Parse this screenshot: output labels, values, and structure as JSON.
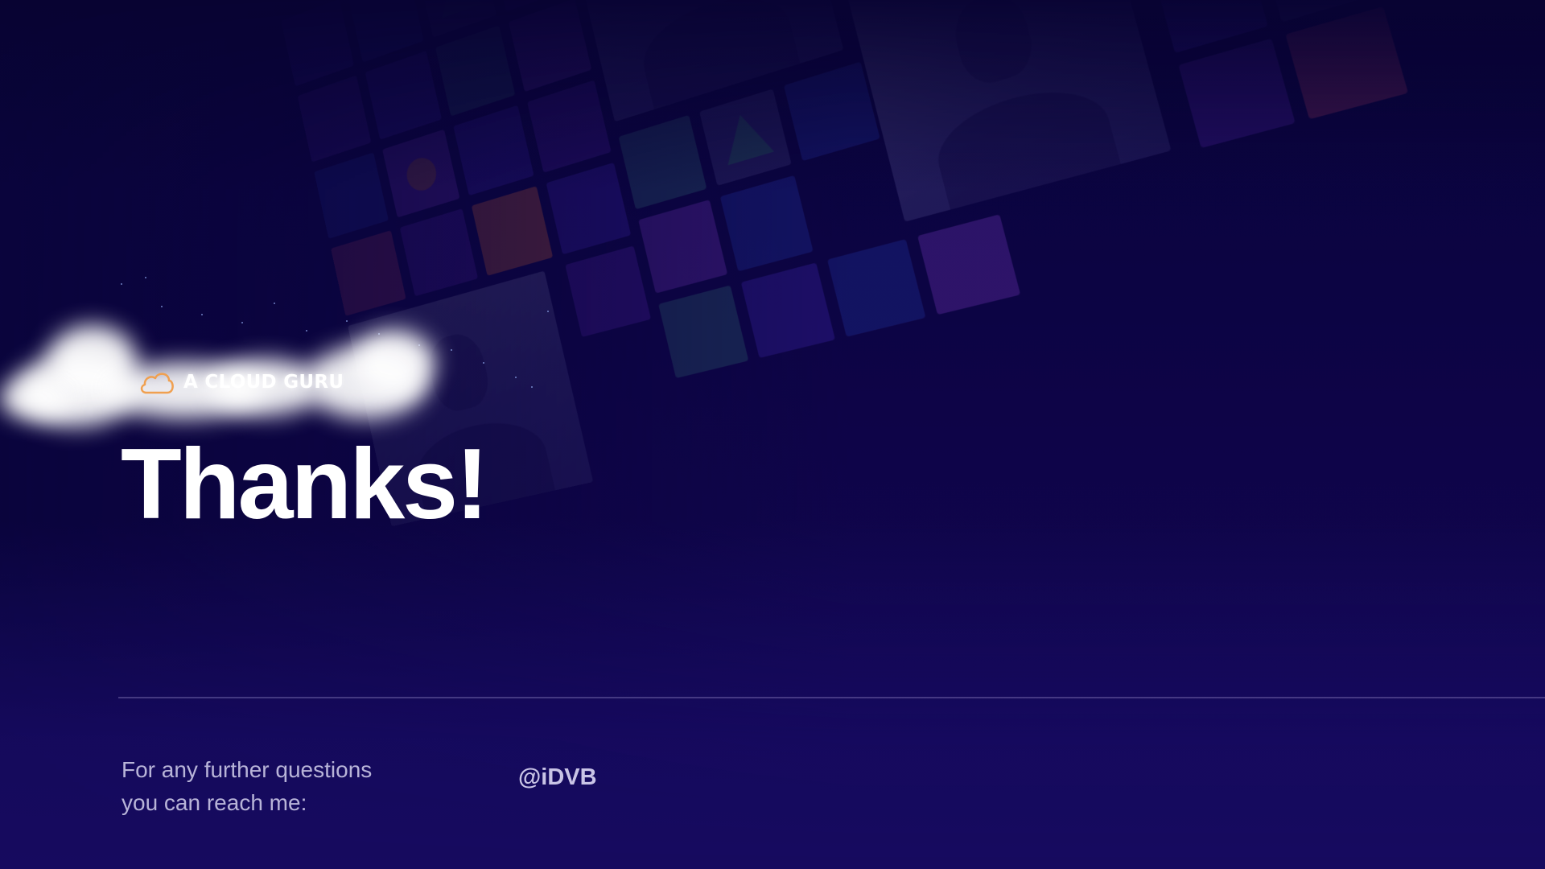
{
  "logo": {
    "text": "A CLOUD GURU",
    "icon": "cloud-icon",
    "icon_color": "#f0a050"
  },
  "slide": {
    "title": "Thanks!",
    "contact_lines": [
      "For any further questions",
      "you can reach me:"
    ],
    "handle": "@iDVB"
  },
  "colors": {
    "background": "#120651",
    "title": "#ffffff",
    "contact_text": "#b8b4d8",
    "handle": "#c9c4e6"
  }
}
